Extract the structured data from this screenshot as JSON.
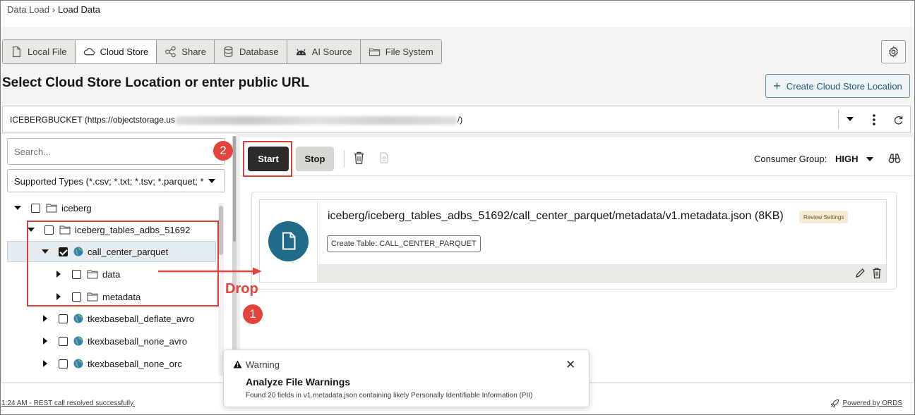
{
  "breadcrumb": {
    "parent": "Data Load",
    "separator": "›",
    "current": "Load Data"
  },
  "tabs": [
    {
      "label": "Local File",
      "icon": "file-icon"
    },
    {
      "label": "Cloud Store",
      "icon": "cloud-icon",
      "active": true
    },
    {
      "label": "Share",
      "icon": "share-icon"
    },
    {
      "label": "Database",
      "icon": "database-icon"
    },
    {
      "label": "AI Source",
      "icon": "ai-icon"
    },
    {
      "label": "File System",
      "icon": "folder-icon"
    }
  ],
  "heading": "Select Cloud Store Location or enter public URL",
  "create_button": {
    "plus": "+",
    "label": "Create Cloud Store Location"
  },
  "location": {
    "prefix": "ICEBERGBUCKET (https://objectstorage.us",
    "suffix": "/)"
  },
  "sidebar": {
    "search_placeholder": "Search...",
    "types_label": "Supported Types (*.csv; *.txt; *.tsv; *.parquet; *",
    "tree": [
      {
        "label": "iceberg",
        "kind": "folder",
        "expanded": true,
        "checked": false
      },
      {
        "label": "iceberg_tables_adbs_51692",
        "kind": "folder",
        "expanded": true,
        "checked": false
      },
      {
        "label": "call_center_parquet",
        "kind": "globe",
        "expanded": true,
        "checked": true,
        "selected": true
      },
      {
        "label": "data",
        "kind": "folder",
        "expanded": false,
        "checked": false
      },
      {
        "label": "metadata",
        "kind": "folder",
        "expanded": false,
        "checked": false
      },
      {
        "label": "tkexbaseball_deflate_avro",
        "kind": "globe",
        "expanded": false,
        "checked": false
      },
      {
        "label": "tkexbaseball_none_avro",
        "kind": "globe",
        "expanded": false,
        "checked": false
      },
      {
        "label": "tkexbaseball_none_orc",
        "kind": "globe",
        "expanded": false,
        "checked": false
      }
    ]
  },
  "toolbar": {
    "start_label": "Start",
    "stop_label": "Stop",
    "consumer_label": "Consumer Group:",
    "consumer_value": "HIGH"
  },
  "file_card": {
    "path": "iceberg/iceberg_tables_adbs_51692/call_center_parquet/metadata/v1.metadata.json (8KB)",
    "badge": "Review Settings",
    "create_table": "Create Table: CALL_CENTER_PARQUET"
  },
  "status": {
    "left": "1:24 AM - REST call resolved successfully.",
    "right": "Powered by ORDS"
  },
  "toast": {
    "type": "Warning",
    "close": "✕",
    "title": "Analyze File Warnings",
    "message": "Found 20 fields in v1.metadata.json containing likely Personally Identifiable Information (PII)"
  },
  "annotations": {
    "step1": "1",
    "step2": "2",
    "drop": "Drop"
  },
  "colors": {
    "accent": "#1f6b89",
    "annotation_red": "#e2433a",
    "start_button": "#2d2b29",
    "badge_bg": "#f7ebd8"
  }
}
